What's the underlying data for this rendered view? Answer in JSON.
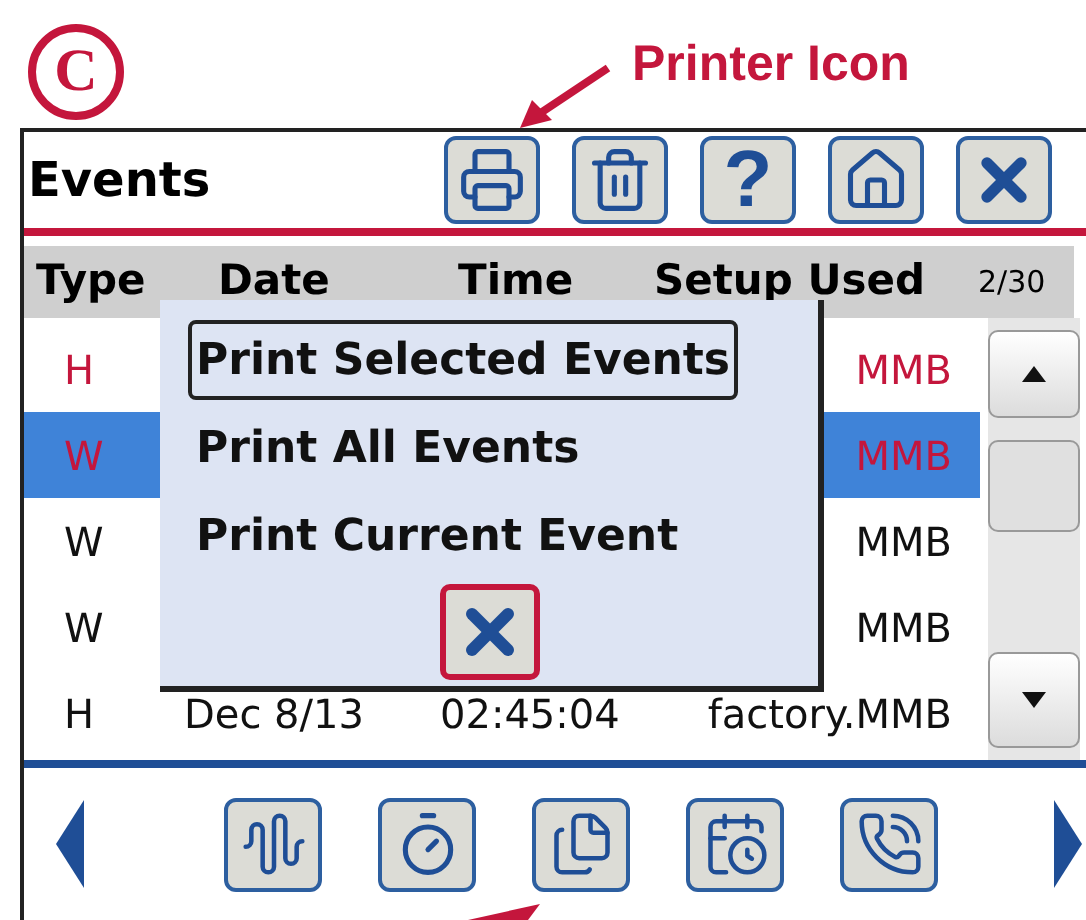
{
  "figure_label": "C",
  "annotation": {
    "text": "Printer Icon"
  },
  "screen": {
    "title": "Events",
    "toolbar": [
      {
        "kind": "printer"
      },
      {
        "kind": "trash"
      },
      {
        "kind": "help",
        "label": "?"
      },
      {
        "kind": "home"
      },
      {
        "kind": "close"
      }
    ],
    "columns": [
      "Type",
      "Date",
      "Time",
      "Setup Used"
    ],
    "page_counter": "2/30",
    "rows": [
      {
        "type": "H",
        "setup": "MMB",
        "flagged": true,
        "selected": false
      },
      {
        "type": "W",
        "setup": "MMB",
        "flagged": true,
        "selected": true
      },
      {
        "type": "W",
        "setup": "MMB",
        "flagged": false,
        "selected": false
      },
      {
        "type": "W",
        "setup": "MMB",
        "flagged": false,
        "selected": false
      },
      {
        "type": "H",
        "date": "Dec 8/13",
        "time": "02:45:04",
        "setup": "factory.MMB",
        "flagged": false,
        "selected": false
      }
    ],
    "popup": {
      "items": [
        {
          "label": "Print Selected Events",
          "selected": true
        },
        {
          "label": "Print All Events",
          "selected": false
        },
        {
          "label": "Print Current Event",
          "selected": false
        }
      ]
    },
    "bottom_bar": [
      {
        "kind": "waveform"
      },
      {
        "kind": "timer"
      },
      {
        "kind": "documents"
      },
      {
        "kind": "calendar"
      },
      {
        "kind": "phone"
      }
    ]
  }
}
